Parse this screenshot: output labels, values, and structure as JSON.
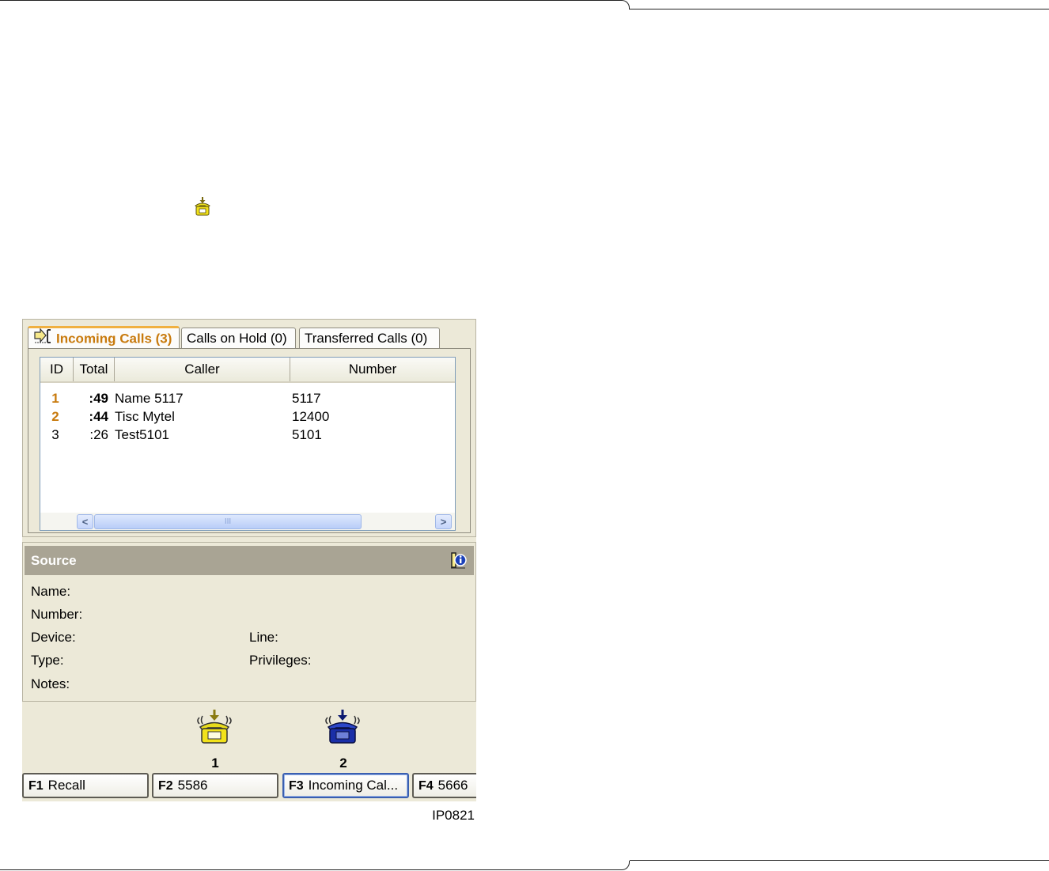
{
  "inline_icon": "ringing-phone-icon",
  "tabs": [
    {
      "label": "Incoming Calls (3)",
      "icon": "incoming-calls-icon",
      "active": true
    },
    {
      "label": "Calls on Hold (0)",
      "active": false
    },
    {
      "label": "Transferred Calls (0)",
      "active": false
    }
  ],
  "table": {
    "columns": [
      "ID",
      "Total",
      "Caller",
      "Number"
    ],
    "rows": [
      {
        "id": "1",
        "total": ":49",
        "caller": "Name 5117",
        "number": "5117",
        "highlighted": true
      },
      {
        "id": "2",
        "total": ":44",
        "caller": "Tisc Mytel",
        "number": "12400",
        "highlighted": true
      },
      {
        "id": "3",
        "total": ":26",
        "caller": "Test5101",
        "number": "5101",
        "highlighted": false
      }
    ],
    "scroll_left": "<",
    "scroll_right": ">",
    "scroll_grip": "III"
  },
  "source": {
    "title": "Source",
    "fields": {
      "name": "Name:",
      "number": "Number:",
      "device": "Device:",
      "line": "Line:",
      "type": "Type:",
      "privileges": "Privileges:",
      "notes": "Notes:"
    }
  },
  "lines": [
    {
      "number": "1",
      "icon": "ringing-phone-yellow-icon"
    },
    {
      "number": "2",
      "icon": "ringing-phone-blue-icon"
    }
  ],
  "function_keys": [
    {
      "key": "F1",
      "label": "Recall"
    },
    {
      "key": "F2",
      "label": "5586"
    },
    {
      "key": "F3",
      "label": "Incoming Cal..."
    },
    {
      "key": "F4",
      "label": "5666"
    }
  ],
  "image_id": "IP0821",
  "colors": {
    "highlight": "#c87a0d",
    "panel": "#ece9d8",
    "source_header": "#a9a494",
    "yellow_phone": "#f2e21a",
    "blue_phone": "#1a2fa8"
  }
}
